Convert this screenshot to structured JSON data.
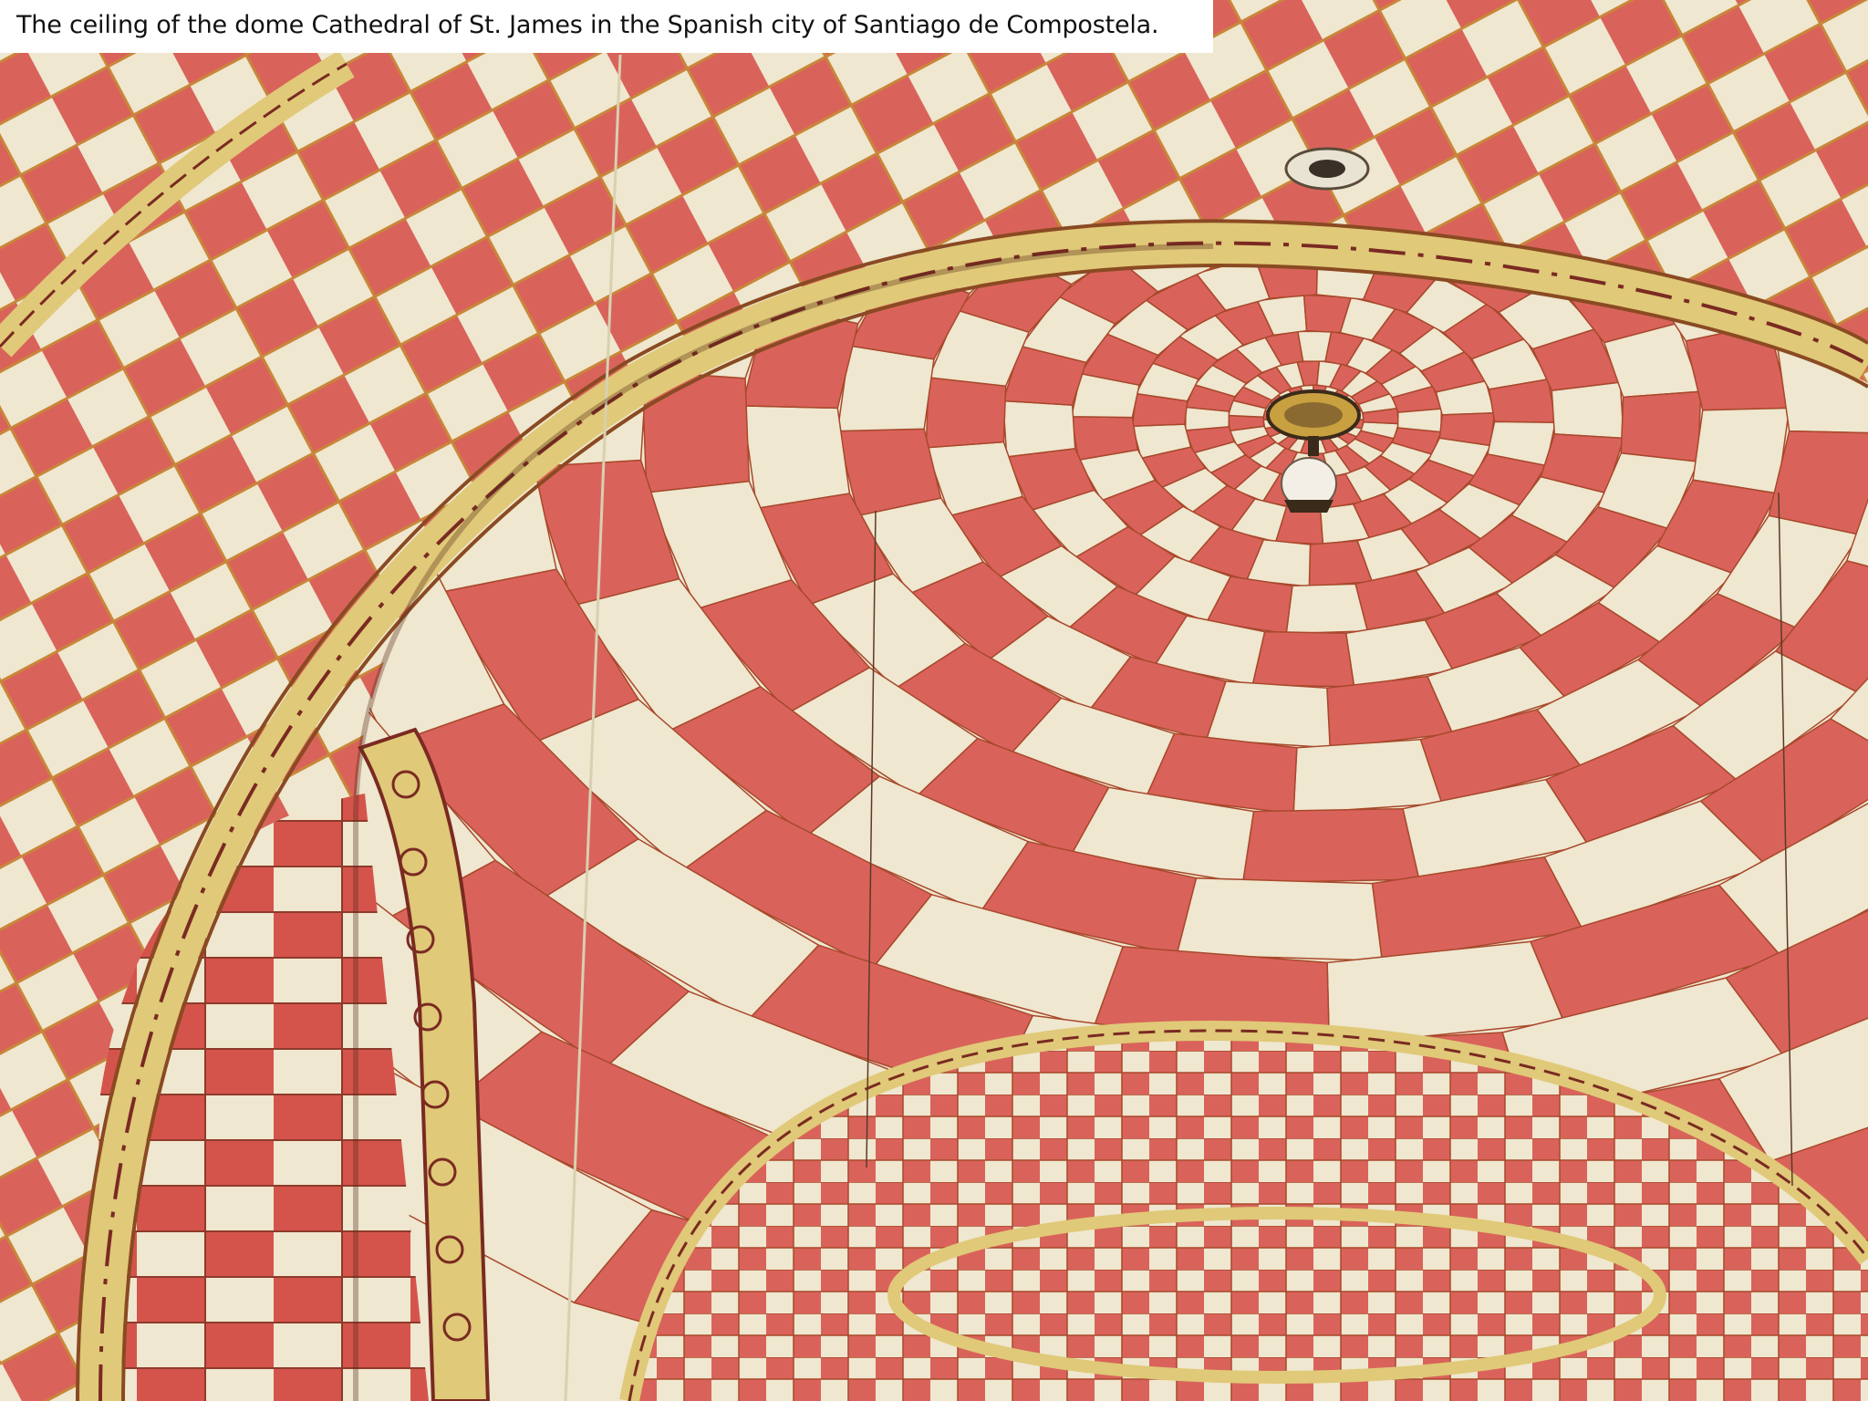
{
  "caption": "The ceiling of the dome Cathedral of St. James in the Spanish city of Santiago de Compostela.",
  "colors": {
    "terracotta": "#d9635a",
    "cream": "#efe7cf",
    "gold_band": "#e0c978",
    "ornament": "#7a2a22",
    "grout": "#a8482c",
    "caption_background": "#ffffff"
  },
  "scene": {
    "subject": "checkered dome ceiling",
    "lamp_icon": "ceiling-lamp-icon"
  }
}
